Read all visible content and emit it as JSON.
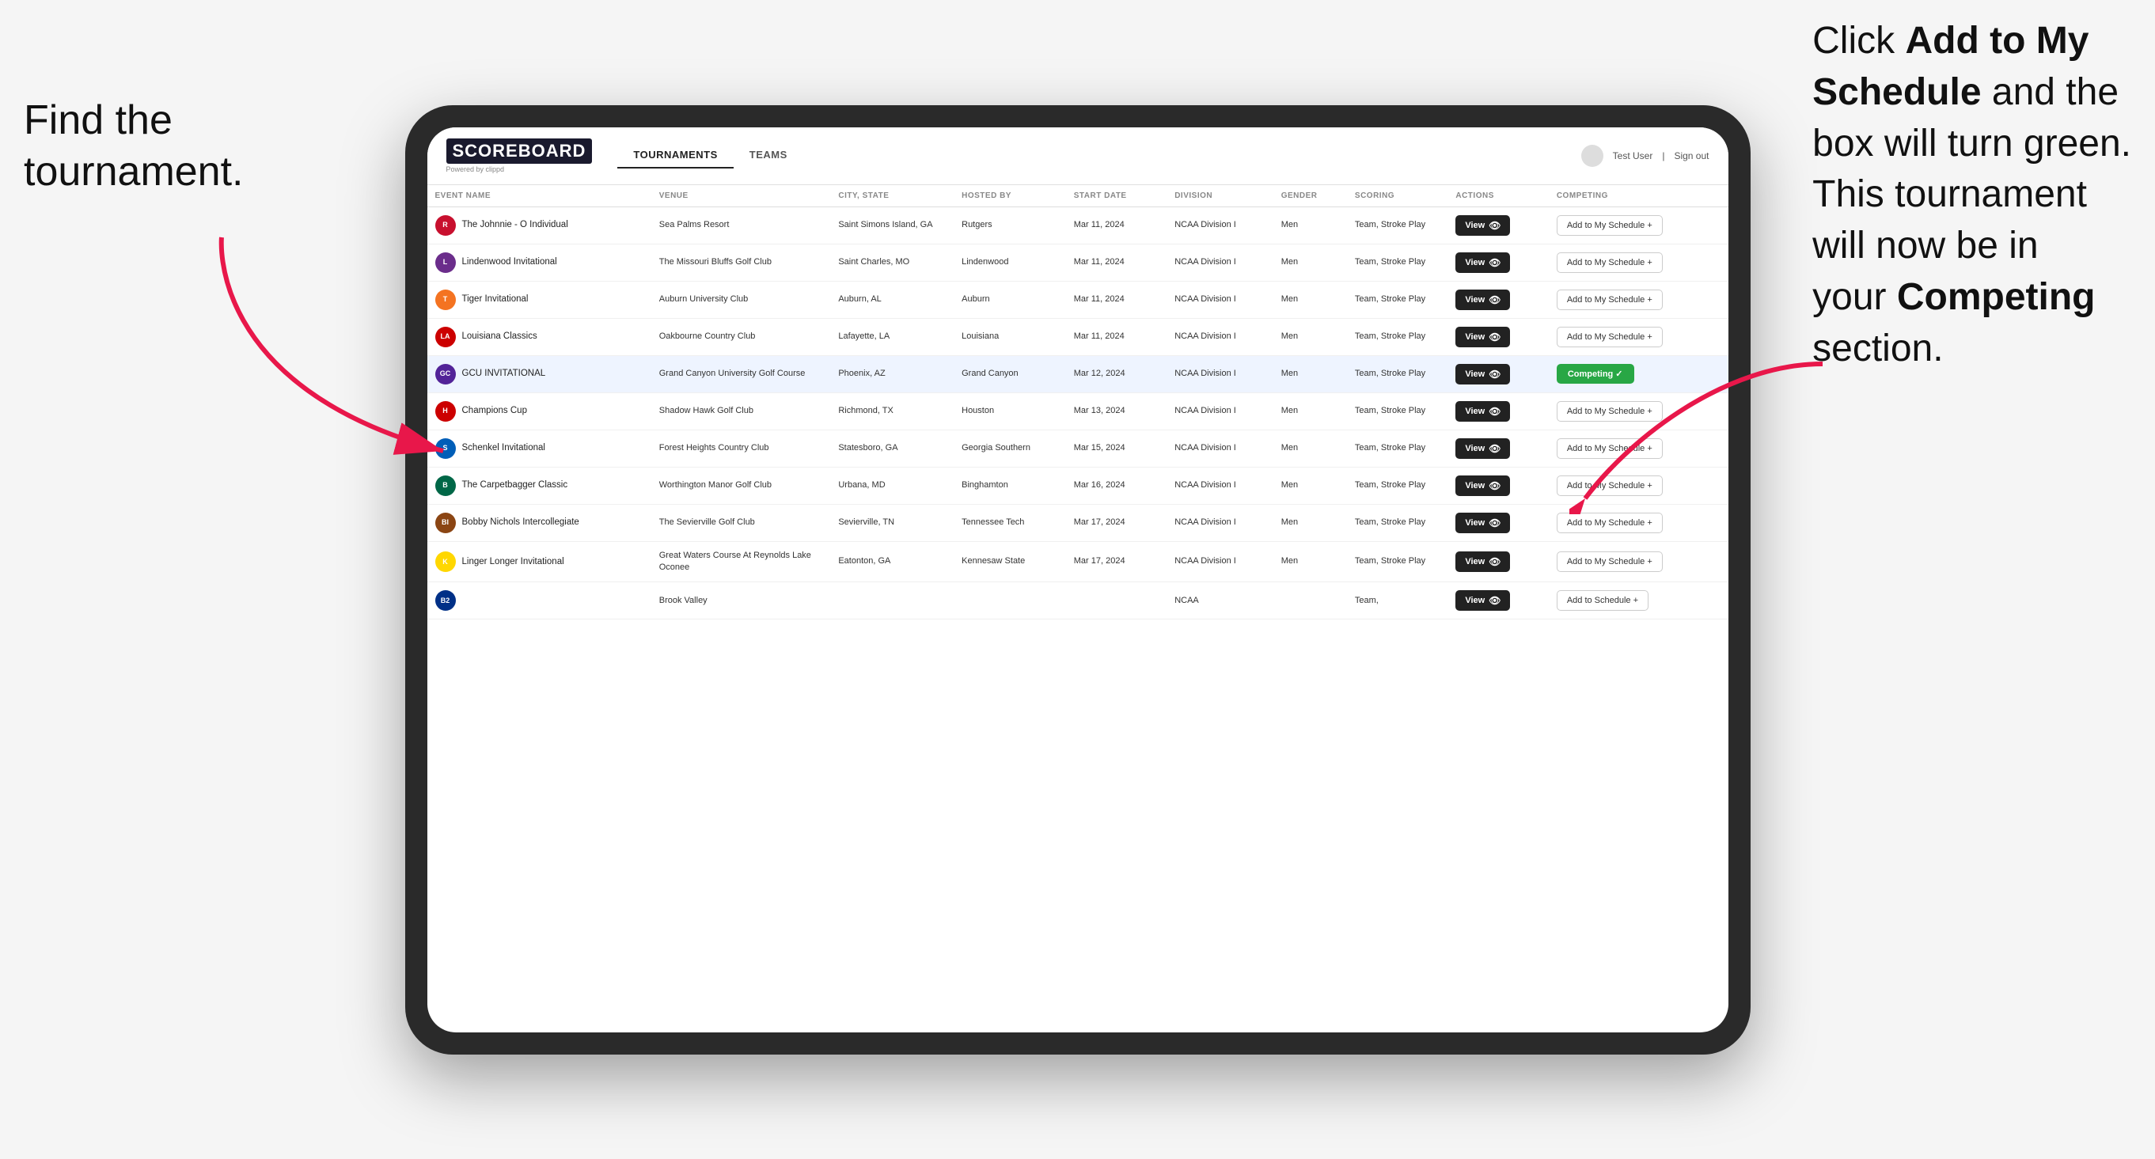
{
  "page": {
    "background": "#f5f5f5"
  },
  "annotation_left": "Find the\ntournament.",
  "annotation_right_parts": [
    {
      "text": "Click ",
      "bold": false
    },
    {
      "text": "Add to My\nSchedule",
      "bold": true
    },
    {
      "text": " and the\nbox will turn green.\nThis tournament\nwill now be in\nyour ",
      "bold": false
    },
    {
      "text": "Competing",
      "bold": true
    },
    {
      "text": "\nsection.",
      "bold": false
    }
  ],
  "header": {
    "logo": "SCOREBOARD",
    "logo_sub": "Powered by clippd",
    "nav": [
      "TOURNAMENTS",
      "TEAMS"
    ],
    "active_nav": "TOURNAMENTS",
    "user": "Test User",
    "sign_out": "Sign out"
  },
  "table": {
    "columns": [
      "EVENT NAME",
      "VENUE",
      "CITY, STATE",
      "HOSTED BY",
      "START DATE",
      "DIVISION",
      "GENDER",
      "SCORING",
      "ACTIONS",
      "COMPETING"
    ],
    "rows": [
      {
        "logo_color": "#c8102e",
        "logo_letter": "R",
        "event": "The Johnnie - O Individual",
        "venue": "Sea Palms Resort",
        "city": "Saint Simons Island, GA",
        "hosted": "Rutgers",
        "date": "Mar 11, 2024",
        "division": "NCAA Division I",
        "gender": "Men",
        "scoring": "Team, Stroke Play",
        "action": "View",
        "competing": "Add to My Schedule +",
        "highlighted": false,
        "competing_type": "add"
      },
      {
        "logo_color": "#6b2d8b",
        "logo_letter": "L",
        "event": "Lindenwood Invitational",
        "venue": "The Missouri Bluffs Golf Club",
        "city": "Saint Charles, MO",
        "hosted": "Lindenwood",
        "date": "Mar 11, 2024",
        "division": "NCAA Division I",
        "gender": "Men",
        "scoring": "Team, Stroke Play",
        "action": "View",
        "competing": "Add to My Schedule +",
        "highlighted": false,
        "competing_type": "add"
      },
      {
        "logo_color": "#f47321",
        "logo_letter": "T",
        "event": "Tiger Invitational",
        "venue": "Auburn University Club",
        "city": "Auburn, AL",
        "hosted": "Auburn",
        "date": "Mar 11, 2024",
        "division": "NCAA Division I",
        "gender": "Men",
        "scoring": "Team, Stroke Play",
        "action": "View",
        "competing": "Add to My Schedule +",
        "highlighted": false,
        "competing_type": "add"
      },
      {
        "logo_color": "#cc0000",
        "logo_letter": "LA",
        "event": "Louisiana Classics",
        "venue": "Oakbourne Country Club",
        "city": "Lafayette, LA",
        "hosted": "Louisiana",
        "date": "Mar 11, 2024",
        "division": "NCAA Division I",
        "gender": "Men",
        "scoring": "Team, Stroke Play",
        "action": "View",
        "competing": "Add to My Schedule +",
        "highlighted": false,
        "competing_type": "add"
      },
      {
        "logo_color": "#522398",
        "logo_letter": "GCU",
        "event": "GCU INVITATIONAL",
        "venue": "Grand Canyon University Golf Course",
        "city": "Phoenix, AZ",
        "hosted": "Grand Canyon",
        "date": "Mar 12, 2024",
        "division": "NCAA Division I",
        "gender": "Men",
        "scoring": "Team, Stroke Play",
        "action": "View",
        "competing": "Competing ✓",
        "highlighted": true,
        "competing_type": "competing"
      },
      {
        "logo_color": "#cc0000",
        "logo_letter": "H",
        "event": "Champions Cup",
        "venue": "Shadow Hawk Golf Club",
        "city": "Richmond, TX",
        "hosted": "Houston",
        "date": "Mar 13, 2024",
        "division": "NCAA Division I",
        "gender": "Men",
        "scoring": "Team, Stroke Play",
        "action": "View",
        "competing": "Add to My Schedule +",
        "highlighted": false,
        "competing_type": "add"
      },
      {
        "logo_color": "#005eb8",
        "logo_letter": "S",
        "event": "Schenkel Invitational",
        "venue": "Forest Heights Country Club",
        "city": "Statesboro, GA",
        "hosted": "Georgia Southern",
        "date": "Mar 15, 2024",
        "division": "NCAA Division I",
        "gender": "Men",
        "scoring": "Team, Stroke Play",
        "action": "View",
        "competing": "Add to My Schedule +",
        "highlighted": false,
        "competing_type": "add"
      },
      {
        "logo_color": "#006747",
        "logo_letter": "B",
        "event": "The Carpetbagger Classic",
        "venue": "Worthington Manor Golf Club",
        "city": "Urbana, MD",
        "hosted": "Binghamton",
        "date": "Mar 16, 2024",
        "division": "NCAA Division I",
        "gender": "Men",
        "scoring": "Team, Stroke Play",
        "action": "View",
        "competing": "Add to My Schedule +",
        "highlighted": false,
        "competing_type": "add"
      },
      {
        "logo_color": "#8B4513",
        "logo_letter": "BI",
        "event": "Bobby Nichols Intercollegiate",
        "venue": "The Sevierville Golf Club",
        "city": "Sevierville, TN",
        "hosted": "Tennessee Tech",
        "date": "Mar 17, 2024",
        "division": "NCAA Division I",
        "gender": "Men",
        "scoring": "Team, Stroke Play",
        "action": "View",
        "competing": "Add to My Schedule +",
        "highlighted": false,
        "competing_type": "add"
      },
      {
        "logo_color": "#FFD700",
        "logo_letter": "K",
        "event": "Linger Longer Invitational",
        "venue": "Great Waters Course At Reynolds Lake Oconee",
        "city": "Eatonton, GA",
        "hosted": "Kennesaw State",
        "date": "Mar 17, 2024",
        "division": "NCAA Division I",
        "gender": "Men",
        "scoring": "Team, Stroke Play",
        "action": "View",
        "competing": "Add to My Schedule +",
        "highlighted": false,
        "competing_type": "add"
      },
      {
        "logo_color": "#003087",
        "logo_letter": "B2",
        "event": "",
        "venue": "Brook Valley",
        "city": "",
        "hosted": "",
        "date": "",
        "division": "NCAA",
        "gender": "",
        "scoring": "Team,",
        "action": "View",
        "competing": "Add to Schedule +",
        "highlighted": false,
        "competing_type": "add"
      }
    ]
  }
}
